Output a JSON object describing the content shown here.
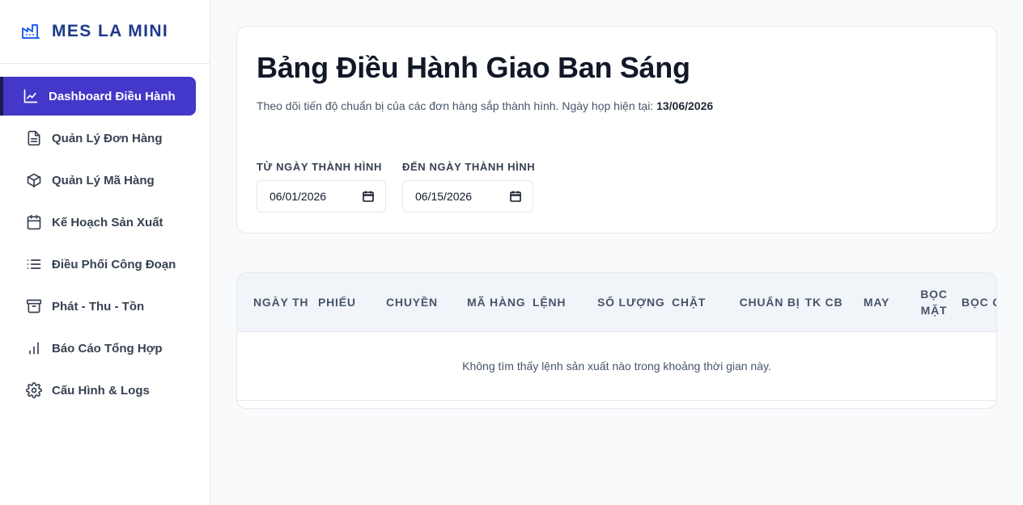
{
  "brand": {
    "name": "MES LA MINI",
    "icon": "factory-icon"
  },
  "sidebar": {
    "items": [
      {
        "label": "Dashboard Điều Hành",
        "icon": "line-chart-icon",
        "active": true
      },
      {
        "label": "Quản Lý Đơn Hàng",
        "icon": "document-icon",
        "active": false
      },
      {
        "label": "Quản Lý Mã Hàng",
        "icon": "box-icon",
        "active": false
      },
      {
        "label": "Kế Hoạch Sản Xuất",
        "icon": "calendar-icon",
        "active": false
      },
      {
        "label": "Điều Phối Công Đoạn",
        "icon": "list-icon",
        "active": false
      },
      {
        "label": "Phát - Thu - Tồn",
        "icon": "archive-icon",
        "active": false
      },
      {
        "label": "Báo Cáo Tổng Hợp",
        "icon": "bar-chart-icon",
        "active": false
      },
      {
        "label": "Cấu Hình & Logs",
        "icon": "gear-icon",
        "active": false
      }
    ]
  },
  "header": {
    "title": "Bảng Điều Hành Giao Ban Sáng",
    "subtitle_prefix": "Theo dõi tiến độ chuẩn bị của các đơn hàng sắp thành hình. Ngày họp hiện tại: ",
    "meeting_date": "13/06/2026"
  },
  "filters": {
    "from_label": "TỪ NGÀY THÀNH HÌNH",
    "from_value": "06/01/2026",
    "to_label": "ĐẾN NGÀY THÀNH HÌNH",
    "to_value": "06/15/2026"
  },
  "table": {
    "columns": [
      "NGÀY TH",
      "PHIẾU",
      "CHUYỀN",
      "MÃ HÀNG",
      "LỆNH",
      "SỐ LƯỢNG",
      "CHẶT",
      "CHUẨN BỊ",
      "TK CB",
      "MAY",
      "BỌC MẶT",
      "BỌC GÓT"
    ],
    "empty_message": "Không tìm thấy lệnh sản xuất nào trong khoảng thời gian này."
  },
  "colors": {
    "accent": "#4338ca",
    "brand": "#1e3a8a"
  }
}
